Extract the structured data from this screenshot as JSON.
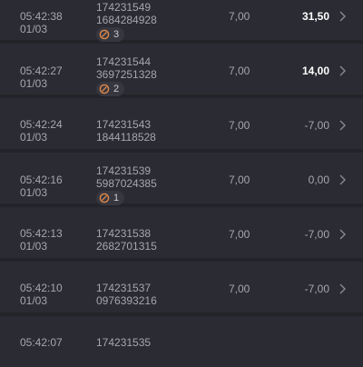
{
  "rows": [
    {
      "time": "05:42:38",
      "date": "01/03",
      "id1": "174231549",
      "id2": "1684284928",
      "badge": "3",
      "stake": "7,00",
      "result": "31,50",
      "positive": true
    },
    {
      "time": "05:42:27",
      "date": "01/03",
      "id1": "174231544",
      "id2": "3697251328",
      "badge": "2",
      "stake": "7,00",
      "result": "14,00",
      "positive": true
    },
    {
      "time": "05:42:24",
      "date": "01/03",
      "id1": "174231543",
      "id2": "1844118528",
      "badge": "",
      "stake": "7,00",
      "result": "-7,00",
      "positive": false
    },
    {
      "time": "05:42:16",
      "date": "01/03",
      "id1": "174231539",
      "id2": "5987024385",
      "badge": "1",
      "stake": "7,00",
      "result": "0,00",
      "positive": false
    },
    {
      "time": "05:42:13",
      "date": "01/03",
      "id1": "174231538",
      "id2": "2682701315",
      "badge": "",
      "stake": "7,00",
      "result": "-7,00",
      "positive": false
    },
    {
      "time": "05:42:10",
      "date": "01/03",
      "id1": "174231537",
      "id2": "0976393216",
      "badge": "",
      "stake": "7,00",
      "result": "-7,00",
      "positive": false
    },
    {
      "time": "05:42:07",
      "date": "",
      "id1": "174231535",
      "id2": "",
      "badge": "",
      "stake": "",
      "result": "",
      "positive": false
    }
  ],
  "icons": {
    "badge_icon": "multiplier-icon",
    "row_arrow": "chevron-right-icon"
  },
  "colors": {
    "background": "#232329",
    "row": "#2b2b33",
    "badge_ring": "#e0894a",
    "text_primary": "#ffffff",
    "text_secondary": "#a6a6ae"
  }
}
